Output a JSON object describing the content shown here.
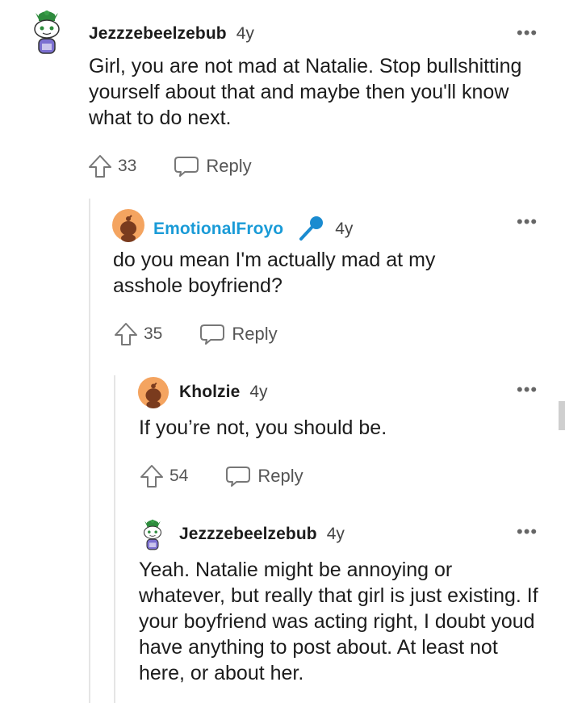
{
  "comments": [
    {
      "username": "Jezzzebeelzebub",
      "age": "4y",
      "body": "Girl, you are not mad at Natalie. Stop bullshitting yourself about that and maybe then you'll know what to do next.",
      "score": "33",
      "reply_label": "Reply",
      "avatar": "snoo-avatar-with-green-hat-icon"
    },
    {
      "username": "EmotionalFroyo",
      "age": "4y",
      "body": "do you mean I'm actually mad at my asshole boyfriend?",
      "score": "35",
      "reply_label": "Reply",
      "avatar": "default-orange-snoo-avatar-icon",
      "badge": "microphone-icon",
      "is_op": true
    },
    {
      "username": "Kholzie",
      "age": "4y",
      "body": "If you’re not, you should be.",
      "score": "54",
      "reply_label": "Reply",
      "avatar": "default-orange-snoo-avatar-icon"
    },
    {
      "username": "Jezzzebeelzebub",
      "age": "4y",
      "body": "Yeah. Natalie might be annoying or whatever, but really that girl is just existing. If your boyfriend was acting right, I doubt youd have anything to post about. At least not here, or about her.",
      "avatar": "snoo-avatar-with-green-hat-icon"
    }
  ],
  "more_label": "•••",
  "colors": {
    "op_username": "#1a9bd7",
    "avatar_orange": "#f4a460",
    "thread_line": "#e5e5e5"
  }
}
